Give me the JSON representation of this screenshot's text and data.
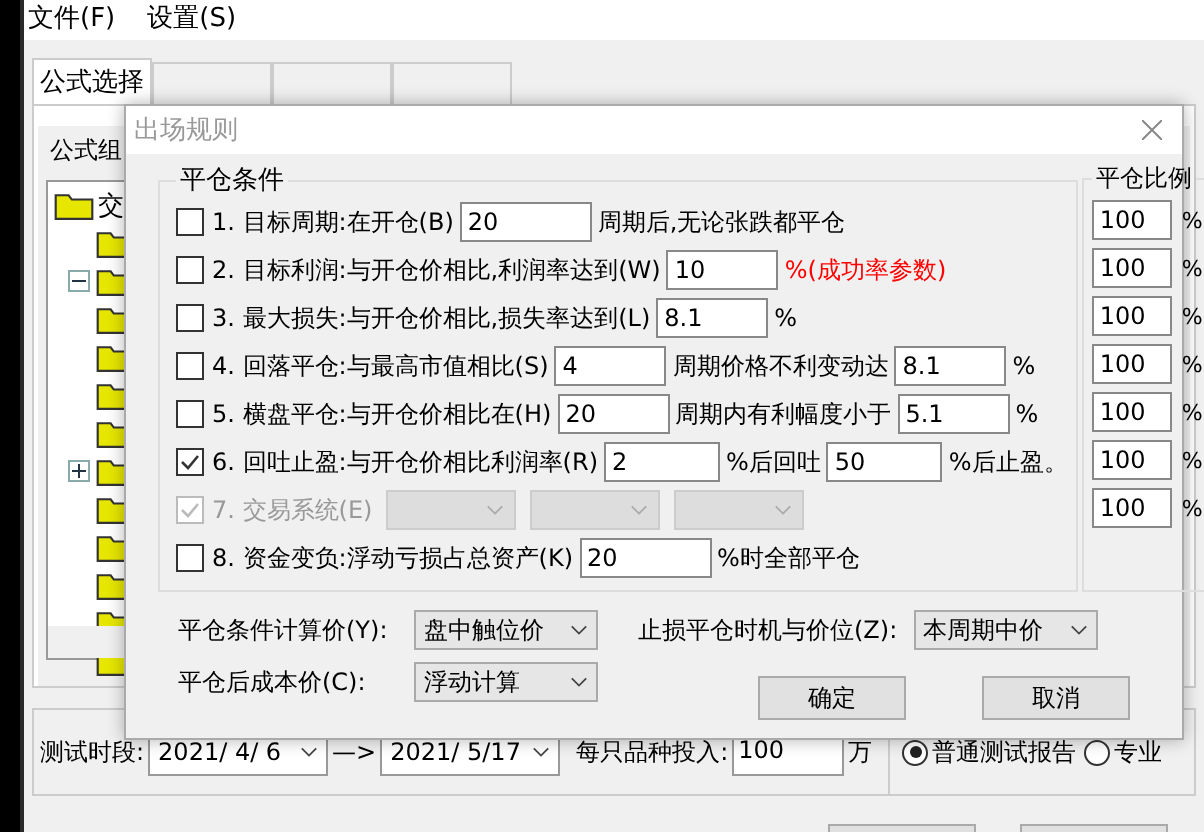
{
  "menu": [
    "文件(F)",
    "设置(S)"
  ],
  "tabs": [
    {
      "label": "公式选择",
      "selected": true
    },
    {
      "selected": false
    },
    {
      "selected": false
    },
    {
      "selected": false
    }
  ],
  "formula_group": {
    "label": "公式组",
    "tree": {
      "label": "交",
      "children": [
        {
          "kind": "folder"
        },
        {
          "kind": "folder",
          "expanded": true
        },
        {
          "kind": "folder"
        },
        {
          "kind": "folder"
        },
        {
          "kind": "folder"
        },
        {
          "kind": "folder"
        },
        {
          "kind": "folder",
          "expanded": false
        },
        {
          "kind": "folder"
        },
        {
          "kind": "folder"
        },
        {
          "kind": "folder"
        },
        {
          "kind": "folder"
        },
        {
          "kind": "folder"
        }
      ]
    }
  },
  "test_period": {
    "label": "测试时段:",
    "start": "2021/ 4/ 6",
    "arrow": "—>",
    "end": "2021/ 5/17"
  },
  "investment": {
    "label": "每只品种投入:",
    "value": "100",
    "unit": "万"
  },
  "report_options": [
    {
      "label": "普通测试报告",
      "selected": true
    },
    {
      "label": "专业",
      "selected": false
    }
  ],
  "dialog": {
    "title": "出场规则",
    "conditions_title": "平仓条件",
    "conditions": [
      {
        "checked": false,
        "disabled": false,
        "parts": [
          {
            "kind": "text",
            "text": "1. 目标周期:在开仓(B)"
          },
          {
            "kind": "input",
            "value": "20"
          },
          {
            "kind": "text",
            "text": "周期后,无论张跌都平仓"
          }
        ]
      },
      {
        "checked": false,
        "disabled": false,
        "parts": [
          {
            "kind": "text",
            "text": "2. 目标利润:与开仓价相比,利润率达到(W)"
          },
          {
            "kind": "input",
            "value": "10"
          },
          {
            "kind": "note",
            "text": "%(成功率参数)"
          }
        ]
      },
      {
        "checked": false,
        "disabled": false,
        "parts": [
          {
            "kind": "text",
            "text": "3. 最大损失:与开仓价相比,损失率达到(L)"
          },
          {
            "kind": "input",
            "value": "8.1"
          },
          {
            "kind": "text",
            "text": "%"
          }
        ]
      },
      {
        "checked": false,
        "disabled": false,
        "parts": [
          {
            "kind": "text",
            "text": "4. 回落平仓:与最高市值相比(S)"
          },
          {
            "kind": "input",
            "value": "4"
          },
          {
            "kind": "text",
            "text": "周期价格不利变动达"
          },
          {
            "kind": "input",
            "value": "8.1"
          },
          {
            "kind": "text",
            "text": "%"
          }
        ]
      },
      {
        "checked": false,
        "disabled": false,
        "parts": [
          {
            "kind": "text",
            "text": "5. 横盘平仓:与开仓价相比在(H)"
          },
          {
            "kind": "input",
            "value": "20"
          },
          {
            "kind": "text",
            "text": "周期内有利幅度小于"
          },
          {
            "kind": "input",
            "value": "5.1"
          },
          {
            "kind": "text",
            "text": "%"
          }
        ]
      },
      {
        "checked": true,
        "disabled": false,
        "parts": [
          {
            "kind": "text",
            "text": "6. 回吐止盈:与开仓价相比利润率(R)"
          },
          {
            "kind": "input",
            "value": "2"
          },
          {
            "kind": "text",
            "text": "%后回吐"
          },
          {
            "kind": "input",
            "value": "50"
          },
          {
            "kind": "text",
            "text": "%后止盈。"
          }
        ]
      },
      {
        "checked": true,
        "disabled": true,
        "parts": [
          {
            "kind": "text",
            "text": "7. 交易系统(E)"
          },
          {
            "kind": "select"
          },
          {
            "kind": "select"
          },
          {
            "kind": "select"
          }
        ]
      },
      {
        "checked": false,
        "disabled": false,
        "parts": [
          {
            "kind": "text",
            "text": "8. 资金变负:浮动亏损占总资产(K)"
          },
          {
            "kind": "input",
            "value": "20"
          },
          {
            "kind": "text",
            "text": "%时全部平仓"
          }
        ]
      }
    ],
    "ratio_title": "平仓比例",
    "ratios": [
      {
        "value": "100",
        "unit": "%"
      },
      {
        "value": "100",
        "unit": "%"
      },
      {
        "value": "100",
        "unit": "%"
      },
      {
        "value": "100",
        "unit": "%"
      },
      {
        "value": "100",
        "unit": "%"
      },
      {
        "value": "100",
        "unit": "%"
      },
      {
        "value": "100",
        "unit": "%"
      }
    ],
    "calc_price": {
      "label": "平仓条件计算价(Y):",
      "value": "盘中触位价"
    },
    "stop_timing": {
      "label": "止损平仓时机与价位(Z):",
      "value": "本周期中价"
    },
    "cost_price": {
      "label": "平仓后成本价(C):",
      "value": "浮动计算"
    },
    "buttons": [
      "确定",
      "取消"
    ]
  }
}
